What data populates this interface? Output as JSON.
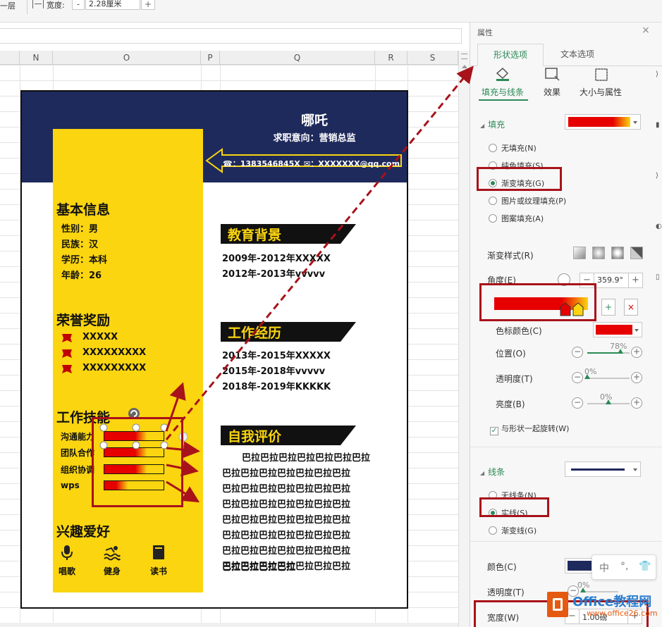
{
  "ribbon": {
    "layer_label": "一层",
    "width_label": "宽度:",
    "width_value": "2.28厘米",
    "minus": "-",
    "plus": "+"
  },
  "sheet": {
    "columns": [
      "N",
      "O",
      "P",
      "Q",
      "R",
      "S"
    ]
  },
  "resume": {
    "name": "哪吒",
    "objective": "求职意向：营销总监",
    "phone": "☎：1383546845X",
    "email": "✉：XXXXXXX@qq.com",
    "basic": {
      "title": "基本信息",
      "lines": [
        "性别：男",
        "民族：汉",
        "学历：本科",
        "年龄：26"
      ]
    },
    "awards": {
      "title": "荣誉奖励",
      "items": [
        "XXXXX",
        "XXXXXXXXX",
        "XXXXXXXXX"
      ]
    },
    "skills": {
      "title": "工作技能",
      "items": [
        {
          "label": "沟通能力",
          "level": 0.72
        },
        {
          "label": "团队合作",
          "level": 0.72
        },
        {
          "label": "组织协调",
          "level": 0.72
        },
        {
          "label": "wps",
          "level": 0.4
        }
      ]
    },
    "hobbies": {
      "title": "兴趣爱好",
      "items": [
        {
          "label": "唱歌",
          "icon": "microphone-icon"
        },
        {
          "label": "健身",
          "icon": "swim-icon"
        },
        {
          "label": "读书",
          "icon": "book-icon"
        }
      ]
    },
    "education": {
      "title": "教育背景",
      "lines": [
        "2009年-2012年XXXXX",
        "2012年-2013年vvvvv"
      ]
    },
    "work": {
      "title": "工作经历",
      "lines": [
        "2013年-2015年XXXXX",
        "2015年-2018年vvvvv",
        "2018年-2019年KKKKK"
      ]
    },
    "self_eval": {
      "title": "自我评价",
      "lines": [
        "巴拉巴拉巴拉巴拉巴拉巴拉巴拉",
        "巴拉巴拉巴拉巴拉巴拉巴拉巴拉",
        "巴拉巴拉巴拉巴拉巴拉巴拉巴拉",
        "巴拉巴拉巴拉巴拉巴拉巴拉巴拉",
        "巴拉巴拉巴拉巴拉巴拉巴拉巴拉",
        "巴拉巴拉巴拉巴拉巴拉巴拉巴拉",
        "巴拉巴拉巴拉巴拉巴拉巴拉巴拉",
        "巴拉巴拉巴拉巴拉巴拉巴拉巴拉",
        "巴拉巴拉巴拉巴拉"
      ]
    },
    "colors": {
      "navy": "#1f2a5c",
      "yellow": "#fbd50f",
      "red": "#e60000"
    }
  },
  "pane": {
    "title": "属性",
    "close": "×",
    "tabs": [
      "形状选项",
      "文本选项"
    ],
    "subtabs": [
      "填充与线条",
      "效果",
      "大小与属性"
    ],
    "fill": {
      "group": "填充",
      "options": [
        "无填充(N)",
        "纯色填充(S)",
        "渐变填充(G)",
        "图片或纹理填充(P)",
        "图案填充(A)"
      ],
      "selected_index": 2,
      "gradient_style_label": "渐变样式(R)",
      "angle_label": "角度(E)",
      "angle_value": "359.9°",
      "stop_color_label": "色标颜色(C)",
      "position_label": "位置(O)",
      "position_value": "78%",
      "position_level": 0.78,
      "transparency_label": "透明度(T)",
      "transparency_value": "0%",
      "brightness_label": "亮度(B)",
      "brightness_value": "0%",
      "rotate_with_shape": "与形状一起旋转(W)"
    },
    "line": {
      "group": "线条",
      "options": [
        "无线条(N)",
        "实线(S)",
        "渐变线(G)"
      ],
      "selected_index": 1,
      "color_label": "颜色(C)",
      "transparency_label": "透明度(T)",
      "transparency_value": "0%",
      "width_label": "宽度(W)",
      "width_value": "1.00磅"
    }
  },
  "ime": {
    "chars": [
      "中",
      "°,",
      "👕"
    ]
  },
  "watermark": {
    "brand": "Office教程网",
    "url": "www.office26.com"
  }
}
